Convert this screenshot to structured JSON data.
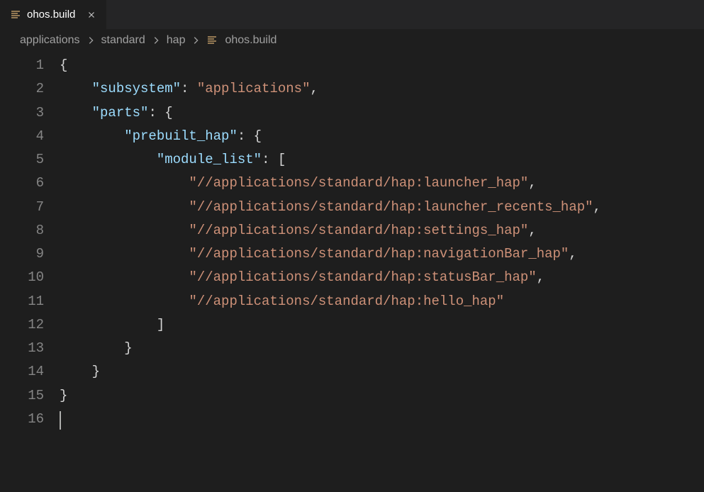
{
  "tab": {
    "filename": "ohos.build",
    "icon": "text-lines-icon"
  },
  "breadcrumb": {
    "segments": [
      "applications",
      "standard",
      "hap"
    ],
    "file": "ohos.build"
  },
  "editor": {
    "line_count": 16,
    "cursor_line": 16
  },
  "code": {
    "subsystem_key": "\"subsystem\"",
    "subsystem_val": "\"applications\"",
    "parts_key": "\"parts\"",
    "prebuilt_hap_key": "\"prebuilt_hap\"",
    "module_list_key": "\"module_list\"",
    "modules": [
      "\"//applications/standard/hap:launcher_hap\"",
      "\"//applications/standard/hap:launcher_recents_hap\"",
      "\"//applications/standard/hap:settings_hap\"",
      "\"//applications/standard/hap:navigationBar_hap\"",
      "\"//applications/standard/hap:statusBar_hap\"",
      "\"//applications/standard/hap:hello_hap\""
    ]
  }
}
